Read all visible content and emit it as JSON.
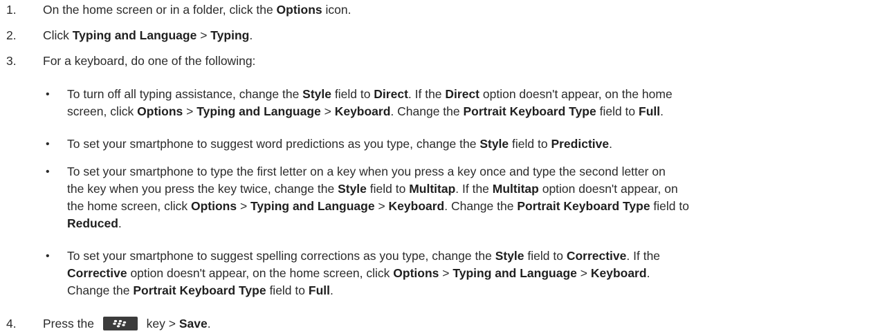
{
  "steps": [
    {
      "number": "1.",
      "parts": [
        "On the home screen or in a folder, click the ",
        "Options",
        " icon."
      ]
    },
    {
      "number": "2.",
      "parts": [
        "Click ",
        "Typing and Language",
        " > ",
        "Typing",
        "."
      ]
    },
    {
      "number": "3.",
      "parts": [
        "For a keyboard, do one of the following:"
      ]
    },
    {
      "number": "4.",
      "parts": [
        "Press the ",
        " key > ",
        "Save",
        "."
      ]
    }
  ],
  "bullets": [
    {
      "lines": [
        [
          "To turn off all typing assistance, change the ",
          "Style",
          " field to ",
          "Direct",
          ". If the ",
          "Direct",
          " option doesn't appear, on the home"
        ],
        [
          "screen, click ",
          "Options",
          " > ",
          "Typing and Language",
          " > ",
          "Keyboard",
          ". Change the ",
          "Portrait Keyboard Type",
          " field to ",
          "Full",
          "."
        ]
      ]
    },
    {
      "lines": [
        [
          "To set your smartphone to suggest word predictions as you type, change the ",
          "Style",
          " field to ",
          "Predictive",
          "."
        ]
      ]
    },
    {
      "lines": [
        [
          "To set your smartphone to type the first letter on a key when you press a key once and type the second letter on"
        ],
        [
          "the key when you press the key twice, change the ",
          "Style",
          " field to ",
          "Multitap",
          ". If the ",
          "Multitap",
          " option doesn't appear, on"
        ],
        [
          "the home screen, click ",
          "Options",
          " > ",
          "Typing and Language",
          " > ",
          "Keyboard",
          ". Change the ",
          "Portrait Keyboard Type",
          " field to"
        ],
        [
          "",
          "Reduced",
          "."
        ]
      ]
    },
    {
      "lines": [
        [
          "To set your smartphone to suggest spelling corrections as you type, change the ",
          "Style",
          " field to ",
          "Corrective",
          ". If the"
        ],
        [
          "",
          "Corrective",
          " option doesn't appear, on the home screen, click ",
          "Options",
          " > ",
          "Typing and Language",
          " > ",
          "Keyboard",
          "."
        ],
        [
          "Change the ",
          "Portrait Keyboard Type",
          " field to ",
          "Full",
          "."
        ]
      ]
    }
  ],
  "bullet_symbol": "•",
  "icons": {
    "menu_key": "blackberry-menu-key-icon"
  }
}
